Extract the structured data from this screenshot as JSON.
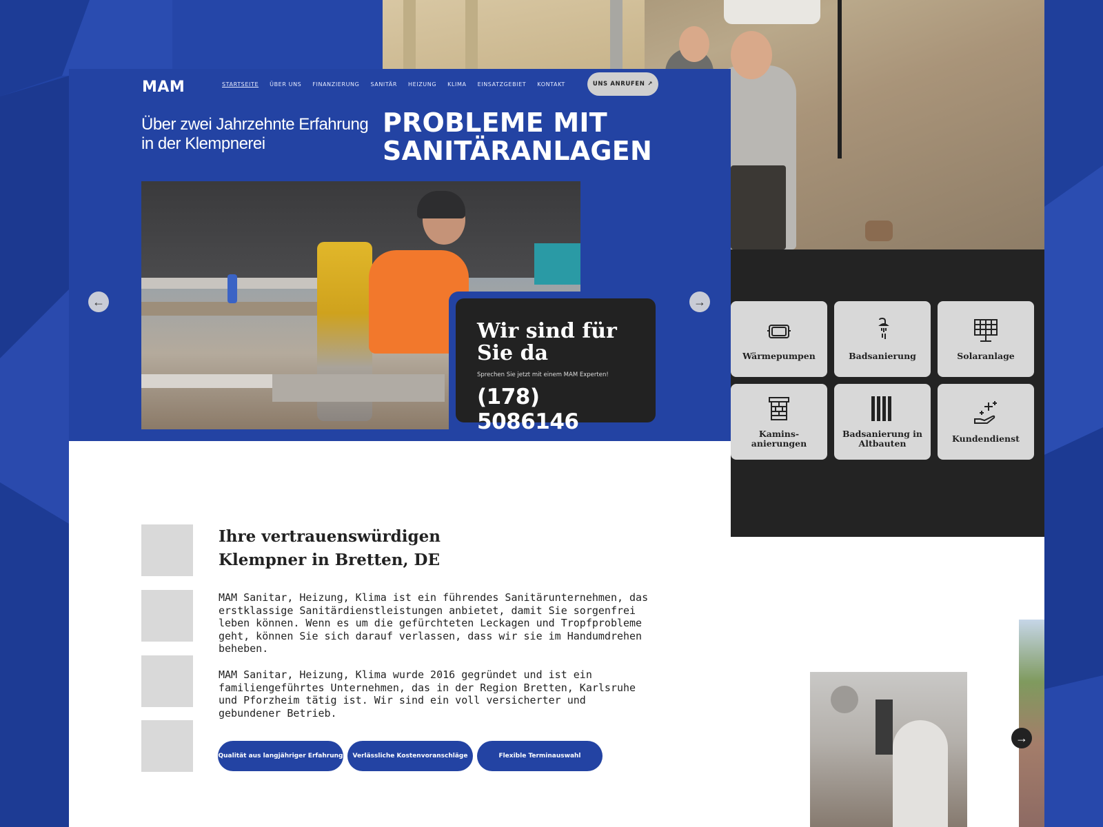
{
  "brand": {
    "logo": "MAM",
    "accent": "#2343a3",
    "dark": "#222222"
  },
  "nav": {
    "items": [
      {
        "label": "STARTSEITE",
        "active": true
      },
      {
        "label": "ÜBER UNS"
      },
      {
        "label": "FINANZIERUNG"
      },
      {
        "label": "SANITÄR"
      },
      {
        "label": "HEIZUNG"
      },
      {
        "label": "KLIMA"
      },
      {
        "label": "EINSATZGEBIET"
      },
      {
        "label": "KONTAKT"
      }
    ],
    "call_button": "UNS ANRUFEN",
    "call_icon": "arrow-up-right-icon"
  },
  "hero": {
    "tagline": "Über zwei Jahrzehnte Erfahrung in der Klempnerei",
    "headline": "PROBLEME MIT SANITÄRANLAGEN",
    "contact": {
      "title": "Wir sind für Sie da",
      "subtitle": "Sprechen Sie jetzt mit einem MAM Experten!",
      "phone": "(178) 5086146"
    },
    "prev_icon": "arrow-left-icon",
    "next_icon": "arrow-right-icon"
  },
  "services": {
    "items": [
      {
        "label": "Wärmepumpen",
        "icon": "heat-pump-icon"
      },
      {
        "label": "Badsanierung",
        "icon": "shower-icon"
      },
      {
        "label": "Solaranlage",
        "icon": "solar-panel-icon"
      },
      {
        "label": "Kamins-anierungen",
        "icon": "chimney-icon"
      },
      {
        "label": "Badsanierung in Altbauten",
        "icon": "pipes-icon"
      },
      {
        "label": "Kundendienst",
        "icon": "service-hand-icon"
      }
    ]
  },
  "about": {
    "title": "Ihre vertrauenswürdigen Klempner in Bretten, DE",
    "paragraphs": [
      "MAM Sanitar, Heizung, Klima ist ein führendes Sanitärunternehmen, das erstklassige Sanitärdienstleistungen anbietet, damit Sie sorgenfrei leben können. Wenn es um die gefürchteten Leckagen und Tropfprobleme geht, können Sie sich darauf verlassen, dass wir sie im Handumdrehen beheben.",
      "MAM Sanitar, Heizung, Klima wurde 2016 gegründet und ist ein familiengeführtes Unternehmen, das in der Region Bretten, Karlsruhe und Pforzheim tätig ist. Wir sind ein voll versicherter und gebundener Betrieb."
    ],
    "pills": [
      "Qualität aus langjähriger Erfahrung",
      "Verlässliche Kostenvoranschläge",
      "Flexible Terminauswahl"
    ]
  },
  "gallery": {
    "next_icon": "arrow-right-icon"
  }
}
